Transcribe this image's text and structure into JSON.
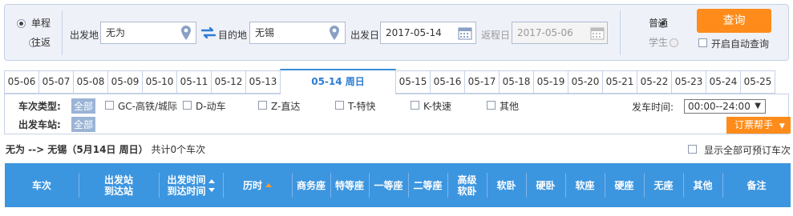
{
  "trip_type": {
    "one_way": "单程",
    "round_trip": "往返"
  },
  "from": {
    "label": "出发地",
    "value": "无为"
  },
  "to": {
    "label": "目的地",
    "value": "无锡"
  },
  "depart_date": {
    "label": "出发日",
    "value": "2017-05-14"
  },
  "return_date": {
    "label": "返程日",
    "value": "2017-05-06"
  },
  "passenger": {
    "normal": "普通",
    "student": "学生"
  },
  "query_button": "查询",
  "auto_query": "开启自动查询",
  "date_tabs": [
    "05-06",
    "05-07",
    "05-08",
    "05-09",
    "05-10",
    "05-11",
    "05-12",
    "05-13",
    "05-14 周日",
    "05-15",
    "05-16",
    "05-17",
    "05-18",
    "05-19",
    "05-20",
    "05-21",
    "05-22",
    "05-23",
    "05-24",
    "05-25"
  ],
  "filters": {
    "train_type_label": "车次类型:",
    "all": "全部",
    "types": [
      "GC-高铁/城际",
      "D-动车",
      "Z-直达",
      "T-特快",
      "K-快速",
      "其他"
    ],
    "station_label": "出发车站:",
    "station_all": "全部",
    "depart_time_label": "发车时间:",
    "depart_time_value": "00:00--24:00",
    "help_button": "订票帮手"
  },
  "summary": {
    "route": "无为 --> 无锡（5月14日  周日）",
    "count": "共计0个车次",
    "show_all": "显示全部可预订车次"
  },
  "table_headers": {
    "train": "车次",
    "station1": "出发站",
    "station2": "到达站",
    "time1": "出发时间",
    "time2": "到达时间",
    "duration": "历时",
    "business": "商务座",
    "premium": "特等座",
    "first": "一等座",
    "second": "二等座",
    "soft_sleeper_hi1": "高级",
    "soft_sleeper_hi2": "软卧",
    "soft_sleeper": "软卧",
    "hard_sleeper": "硬卧",
    "soft_seat": "软座",
    "hard_seat": "硬座",
    "no_seat": "无座",
    "other": "其他",
    "remark": "备注"
  },
  "colors": {
    "accent": "#3c95df",
    "orange": "#ff8c1a"
  }
}
